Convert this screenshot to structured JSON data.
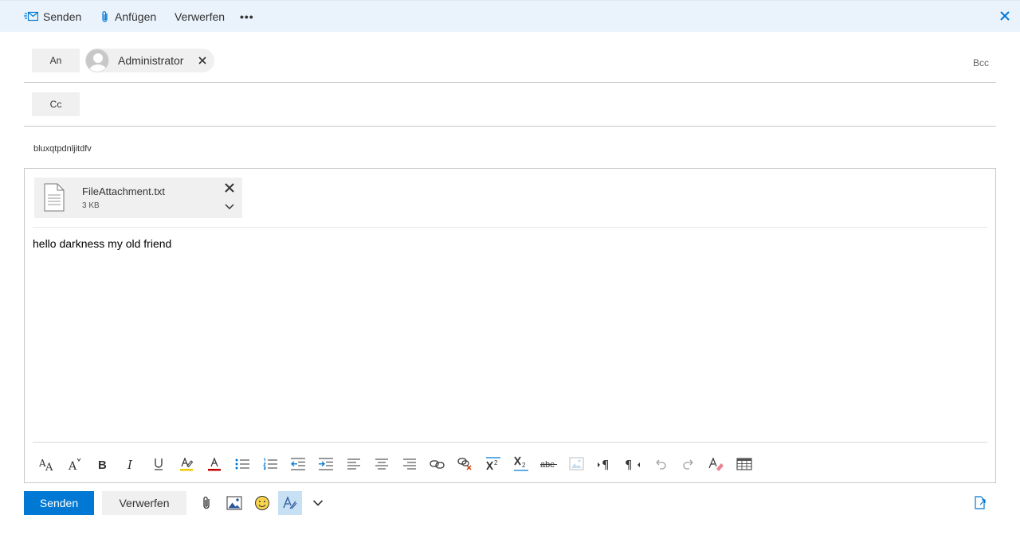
{
  "toolbar": {
    "send_label": "Senden",
    "attach_label": "Anfügen",
    "discard_label": "Verwerfen",
    "more_label": "•••"
  },
  "recipients": {
    "to_label": "An",
    "cc_label": "Cc",
    "bcc_label": "Bcc",
    "to_chips": [
      {
        "name": "Administrator"
      }
    ]
  },
  "subject": {
    "value": "bluxqtpdnljitdfv"
  },
  "attachments": [
    {
      "filename": "FileAttachment.txt",
      "size": "3 KB"
    }
  ],
  "body": {
    "text": "hello darkness my old friend"
  },
  "format_toolbar": [
    "font-size-icon",
    "font-size-grow-icon",
    "bold-icon",
    "italic-icon",
    "underline-icon",
    "highlight-icon",
    "font-color-icon",
    "bullets-icon",
    "numbering-icon",
    "outdent-icon",
    "indent-icon",
    "align-left-icon",
    "align-center-icon",
    "align-right-icon",
    "link-icon",
    "unlink-icon",
    "superscript-icon",
    "subscript-icon",
    "strikethrough-icon",
    "image-icon",
    "ltr-icon",
    "rtl-icon",
    "undo-icon",
    "redo-icon",
    "clear-format-icon",
    "table-icon"
  ],
  "bottom": {
    "send_label": "Senden",
    "discard_label": "Verwerfen"
  },
  "colors": {
    "accent": "#0078d4",
    "topbar_bg": "#eaf3fc",
    "button_bg": "#f0f0f0",
    "highlight_yellow": "#f0c800",
    "font_red": "#c00000"
  }
}
